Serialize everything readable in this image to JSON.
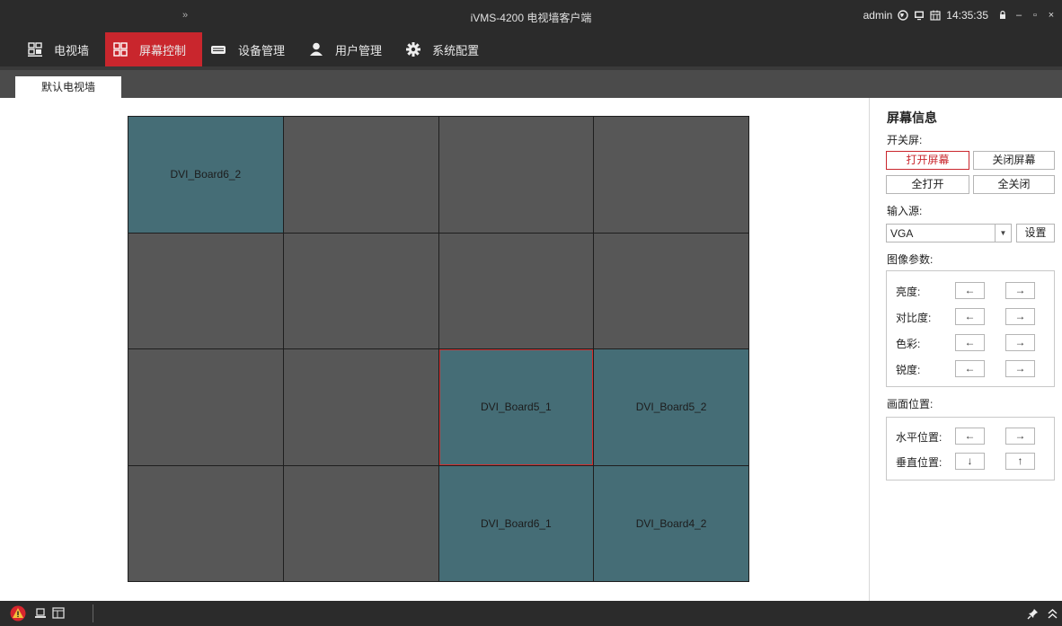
{
  "titlebar": {
    "expand": "»",
    "title": "iVMS-4200 电视墙客户端",
    "user": "admin",
    "time": "14:35:35"
  },
  "nav": {
    "items": [
      {
        "label": "电视墙",
        "icon": "tv-wall-icon",
        "active": false
      },
      {
        "label": "屏幕控制",
        "icon": "screen-grid-icon",
        "active": true
      },
      {
        "label": "设备管理",
        "icon": "device-icon",
        "active": false
      },
      {
        "label": "用户管理",
        "icon": "user-icon",
        "active": false
      },
      {
        "label": "系统配置",
        "icon": "gear-icon",
        "active": false
      }
    ]
  },
  "tabs": [
    {
      "label": "默认电视墙"
    }
  ],
  "wall": {
    "cells": [
      {
        "label": "DVI_Board6_2",
        "style": "teal"
      },
      {
        "label": "",
        "style": "dark"
      },
      {
        "label": "",
        "style": "dark"
      },
      {
        "label": "",
        "style": "dark"
      },
      {
        "label": "",
        "style": "dark"
      },
      {
        "label": "",
        "style": "dark"
      },
      {
        "label": "",
        "style": "dark"
      },
      {
        "label": "",
        "style": "dark"
      },
      {
        "label": "",
        "style": "dark"
      },
      {
        "label": "",
        "style": "dark"
      },
      {
        "label": "DVI_Board5_1",
        "style": "teal",
        "selected": true
      },
      {
        "label": "DVI_Board5_2",
        "style": "teal"
      },
      {
        "label": "",
        "style": "dark"
      },
      {
        "label": "",
        "style": "dark"
      },
      {
        "label": "DVI_Board6_1",
        "style": "teal"
      },
      {
        "label": "DVI_Board4_2",
        "style": "teal"
      }
    ]
  },
  "panel": {
    "title": "屏幕信息",
    "power_label": "开关屏:",
    "open_screen": "打开屏幕",
    "close_screen": "关闭屏幕",
    "open_all": "全打开",
    "close_all": "全关闭",
    "input_label": "输入源:",
    "input_value": "VGA",
    "settings": "设置",
    "image_label": "图像参数:",
    "brightness": "亮度:",
    "contrast": "对比度:",
    "color": "色彩:",
    "sharpness": "锐度:",
    "position_label": "画面位置:",
    "horizontal": "水平位置:",
    "vertical": "垂直位置:",
    "arrow_left": "←",
    "arrow_right": "→",
    "arrow_down": "↓",
    "arrow_up": "↑"
  },
  "colors": {
    "accent": "#c9262d",
    "bar": "#2b2b2b",
    "cell_dark": "#575757",
    "cell_teal": "#456d76"
  }
}
